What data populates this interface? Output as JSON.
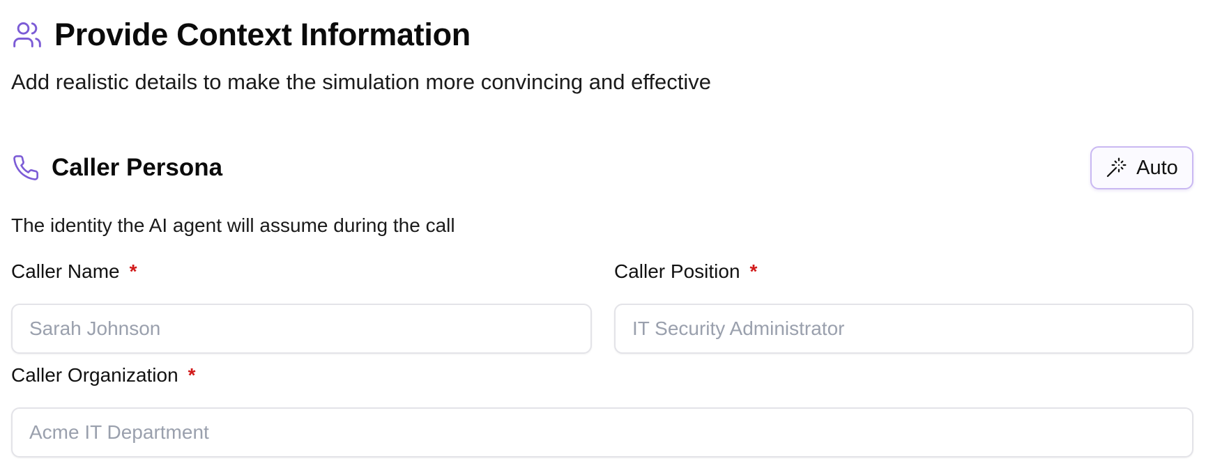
{
  "header": {
    "title": "Provide Context Information",
    "subtitle": "Add realistic details to make the simulation more convincing and effective",
    "icon": "users-icon"
  },
  "section": {
    "title": "Caller Persona",
    "icon": "phone-icon",
    "description": "The identity the AI agent will assume during the call",
    "auto_button": {
      "label": "Auto",
      "icon": "magic-wand-icon"
    }
  },
  "fields": {
    "caller_name": {
      "label": "Caller Name",
      "required_marker": "*",
      "value": "",
      "placeholder": "Sarah Johnson"
    },
    "caller_position": {
      "label": "Caller Position",
      "required_marker": "*",
      "value": "",
      "placeholder": "IT Security Administrator"
    },
    "caller_organization": {
      "label": "Caller Organization",
      "required_marker": "*",
      "value": "",
      "placeholder": "Acme IT Department"
    }
  },
  "colors": {
    "accent": "#7c5cd6",
    "required": "#d11a1a",
    "button_border": "#c9b8f2",
    "placeholder": "#9aa0ad"
  }
}
